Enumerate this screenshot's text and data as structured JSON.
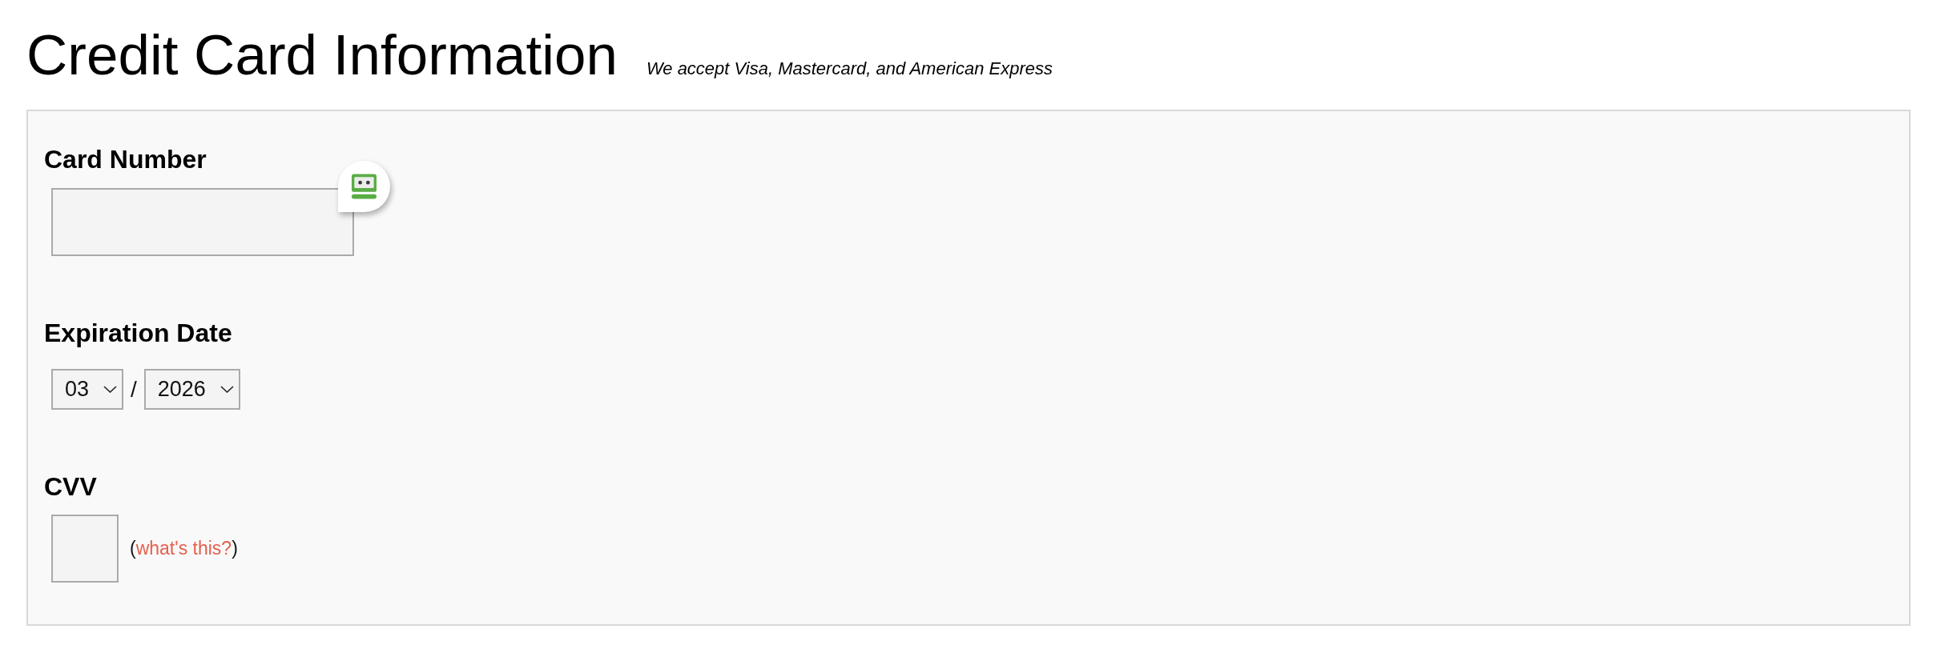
{
  "header": {
    "title": "Credit Card Information",
    "subtitle": "We accept Visa, Mastercard, and American Express"
  },
  "form": {
    "fields": [
      {
        "kind": "text",
        "label": "Card Number",
        "password_manager_badge": true
      },
      {
        "kind": "date",
        "label": "Expiration Date",
        "month": "03",
        "separator": "/",
        "year": "2026"
      },
      {
        "kind": "cvv",
        "label": "CVV",
        "help_open": "(",
        "help_link": "what's this?",
        "help_close": ")"
      }
    ]
  }
}
